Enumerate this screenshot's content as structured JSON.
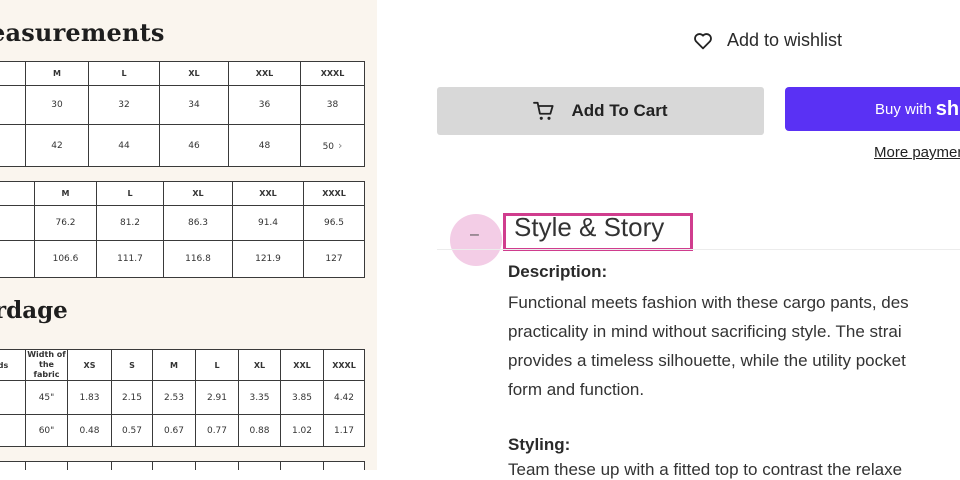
{
  "size_chart": {
    "measurements_title": "easurements",
    "table_inches": {
      "headers": [
        "",
        "M",
        "L",
        "XL",
        "XXL",
        "XXXL"
      ],
      "rows": [
        [
          "",
          "30",
          "32",
          "34",
          "36",
          "38"
        ],
        [
          "",
          "42",
          "44",
          "46",
          "48",
          "50"
        ]
      ]
    },
    "table_cm": {
      "headers": [
        "",
        "M",
        "L",
        "XL",
        "XXL",
        "XXXL"
      ],
      "rows": [
        [
          "",
          "76.2",
          "81.2",
          "86.3",
          "91.4",
          "96.5"
        ],
        [
          "",
          "106.6",
          "111.7",
          "116.8",
          "121.9",
          "127"
        ]
      ]
    },
    "yardage_title": "rdage",
    "table_yardage": {
      "col0": "ds",
      "width_header": "Width of the fabric",
      "sizes": [
        "XS",
        "S",
        "M",
        "L",
        "XL",
        "XXL",
        "XXXL"
      ],
      "rows": [
        {
          "width": "45\"",
          "values": [
            "1.83",
            "2.15",
            "2.53",
            "2.91",
            "3.35",
            "3.85",
            "4.42"
          ]
        },
        {
          "width": "60\"",
          "values": [
            "0.48",
            "0.57",
            "0.67",
            "0.77",
            "0.88",
            "1.02",
            "1.17"
          ]
        }
      ]
    }
  },
  "product": {
    "wishlist_label": "Add to wishlist",
    "add_to_cart_label": "Add To Cart",
    "buy_with_label": "Buy with",
    "buy_with_brand": "sh",
    "more_payment_label": "More paymen"
  },
  "accordion": {
    "toggle_symbol": "–",
    "title": "Style & Story",
    "description_label": "Description:",
    "description_lines": [
      "Functional meets fashion with these cargo pants, des",
      "practicality in mind without sacrificing style. The strai",
      "provides a timeless silhouette, while the utility pocket",
      "form and function."
    ],
    "styling_label": "Styling:",
    "styling_text": "Team these up with a fitted top to contrast the relaxe"
  },
  "colors": {
    "shop_pay_purple": "#5a31f4",
    "highlight_pink": "#d03d8e",
    "cart_gray": "#d8d8d8"
  }
}
